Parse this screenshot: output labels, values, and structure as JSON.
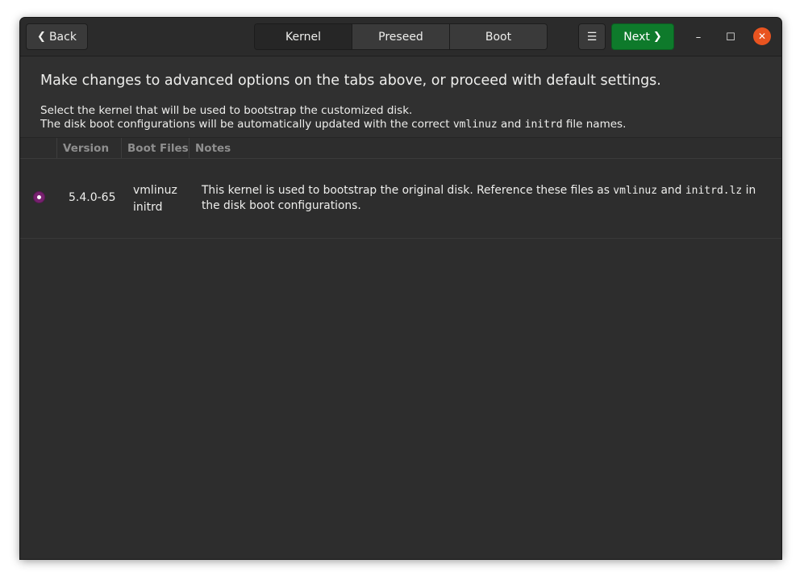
{
  "header": {
    "back_label": "Back",
    "tabs": [
      {
        "label": "Kernel",
        "active": true
      },
      {
        "label": "Preseed",
        "active": false
      },
      {
        "label": "Boot",
        "active": false
      }
    ],
    "menu_glyph": "☰",
    "next_label": "Next",
    "window_controls": {
      "minimize_glyph": "–",
      "maximize_glyph": "☐",
      "close_glyph": "✕"
    }
  },
  "main": {
    "intro": "Make changes to advanced options on the tabs above, or proceed with default settings.",
    "desc_line1": "Select the kernel that will be used to bootstrap the customized disk.",
    "desc_line2_pre": "The disk boot configurations will be automatically updated with the correct ",
    "desc_line2_mono1": "vmlinuz",
    "desc_line2_mid": " and ",
    "desc_line2_mono2": "initrd",
    "desc_line2_post": " file names."
  },
  "table": {
    "columns": [
      "Version",
      "Boot Files",
      "Notes"
    ],
    "rows": [
      {
        "selected": true,
        "version": "5.4.0-65",
        "boot_file_1": "vmlinuz",
        "boot_file_2": "initrd",
        "notes_pre": "This kernel is used to bootstrap the original disk. Reference these files as ",
        "notes_mono1": "vmlinuz",
        "notes_mid": " and ",
        "notes_mono2": "initrd.lz",
        "notes_post1": " in",
        "notes_line2": "the disk boot configurations."
      }
    ]
  },
  "colors": {
    "accent_green": "#0e7a2b",
    "close_orange": "#e95420",
    "radio_purple": "#77216f",
    "window_bg": "#303030"
  },
  "icons": {
    "back": "chevron-left-icon",
    "next": "chevron-right-icon",
    "menu": "hamburger-menu-icon",
    "minimize": "minimize-icon",
    "maximize": "maximize-icon",
    "close": "close-icon"
  }
}
